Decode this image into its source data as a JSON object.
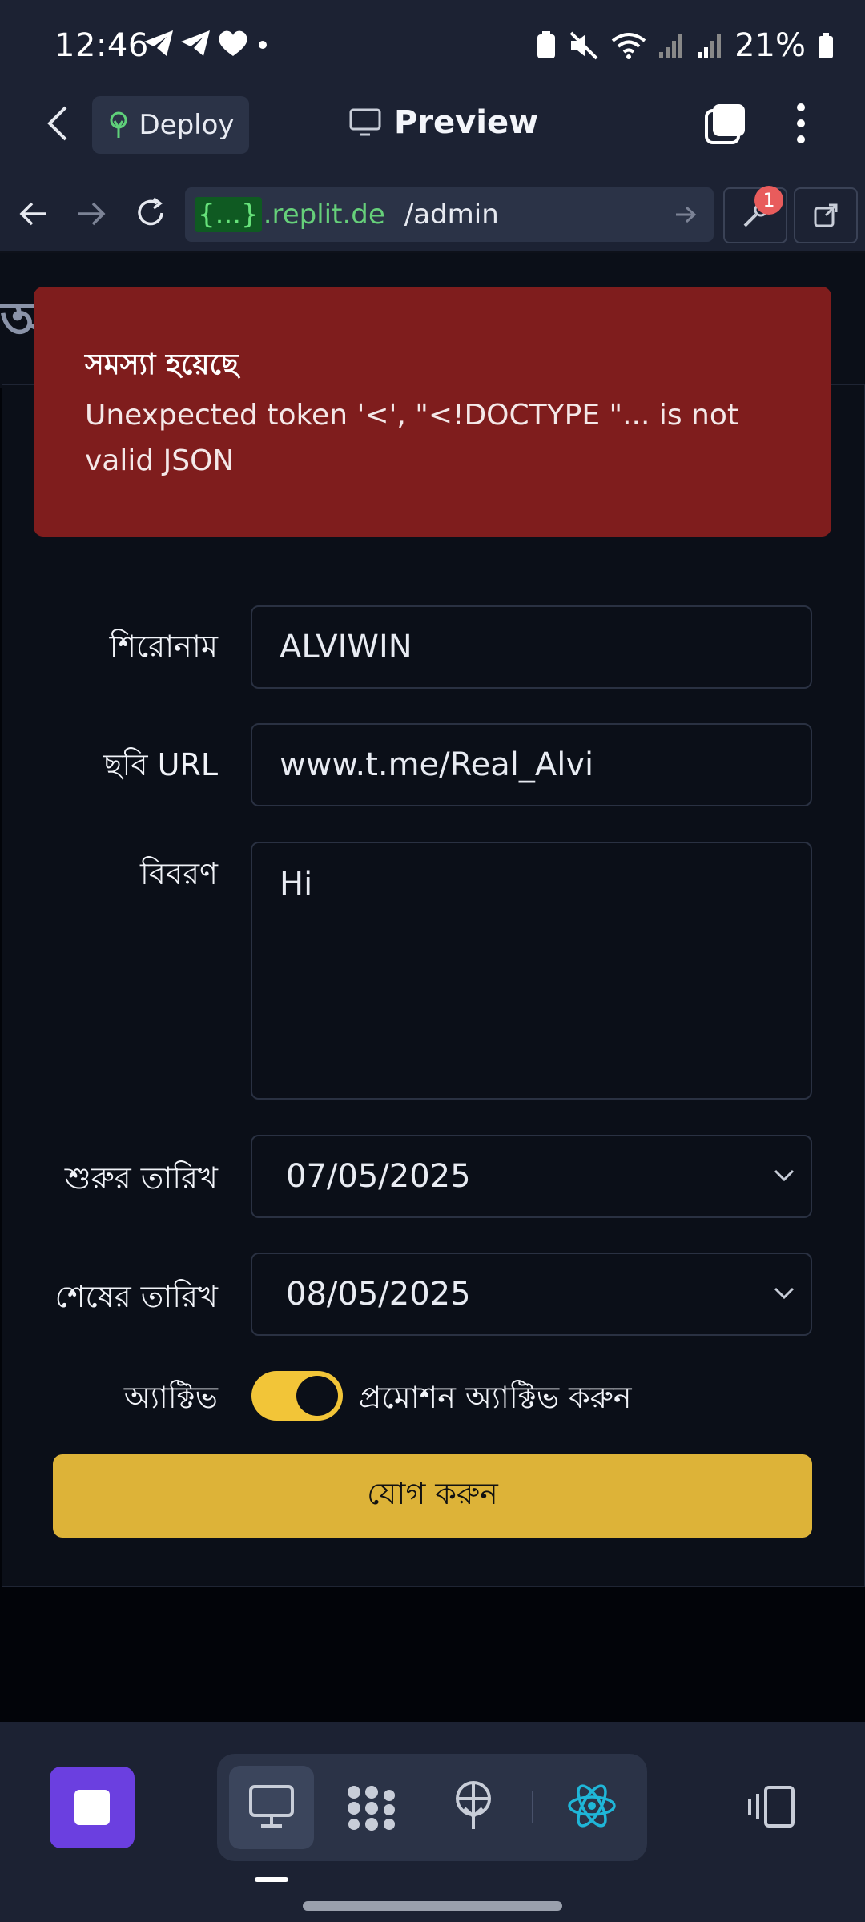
{
  "status_bar": {
    "time": "12:46",
    "battery": "21%"
  },
  "app_header": {
    "deploy_label": "Deploy",
    "title": "Preview"
  },
  "url_bar": {
    "domain_tag": "{...}",
    "domain": ".replit.de",
    "path": "/admin",
    "badge_count": "1"
  },
  "error_toast": {
    "title": "সমস্যা হয়েছে",
    "message": "Unexpected token '<', \"<!DOCTYPE \"... is not valid JSON"
  },
  "form": {
    "title_label": "শিরোনাম",
    "title_value": "ALVIWIN",
    "image_label": "ছবি URL",
    "image_value": "www.t.me/Real_Alvi",
    "desc_label": "বিবরণ",
    "desc_value": "Hi",
    "start_label": "শুরুর তারিখ",
    "start_value": "07/05/2025",
    "end_label": "শেষের তারিখ",
    "end_value": "08/05/2025",
    "active_label": "অ্যাক্টিভ",
    "active_toggle_text": "প্রমোশন অ্যাক্টিভ করুন",
    "active_on": true,
    "submit_label": "যোগ করুন"
  },
  "icons": [
    "back-arrow-icon",
    "deploy-icon",
    "monitor-icon",
    "tabs-icon",
    "more-vert-icon",
    "nav-back-icon",
    "nav-forward-icon",
    "reload-icon",
    "go-arrow-icon",
    "wrench-icon",
    "open-external-icon",
    "stop-icon",
    "preview-monitor-icon",
    "packages-icon",
    "deployments-icon",
    "react-icon",
    "devices-icon"
  ],
  "colors": {
    "error_bg": "#7f1d1d",
    "toggle_on": "#f2c538",
    "submit_bg": "#ddb338",
    "stop_bg": "#6b3fe0",
    "domain_green": "#66d07a"
  }
}
